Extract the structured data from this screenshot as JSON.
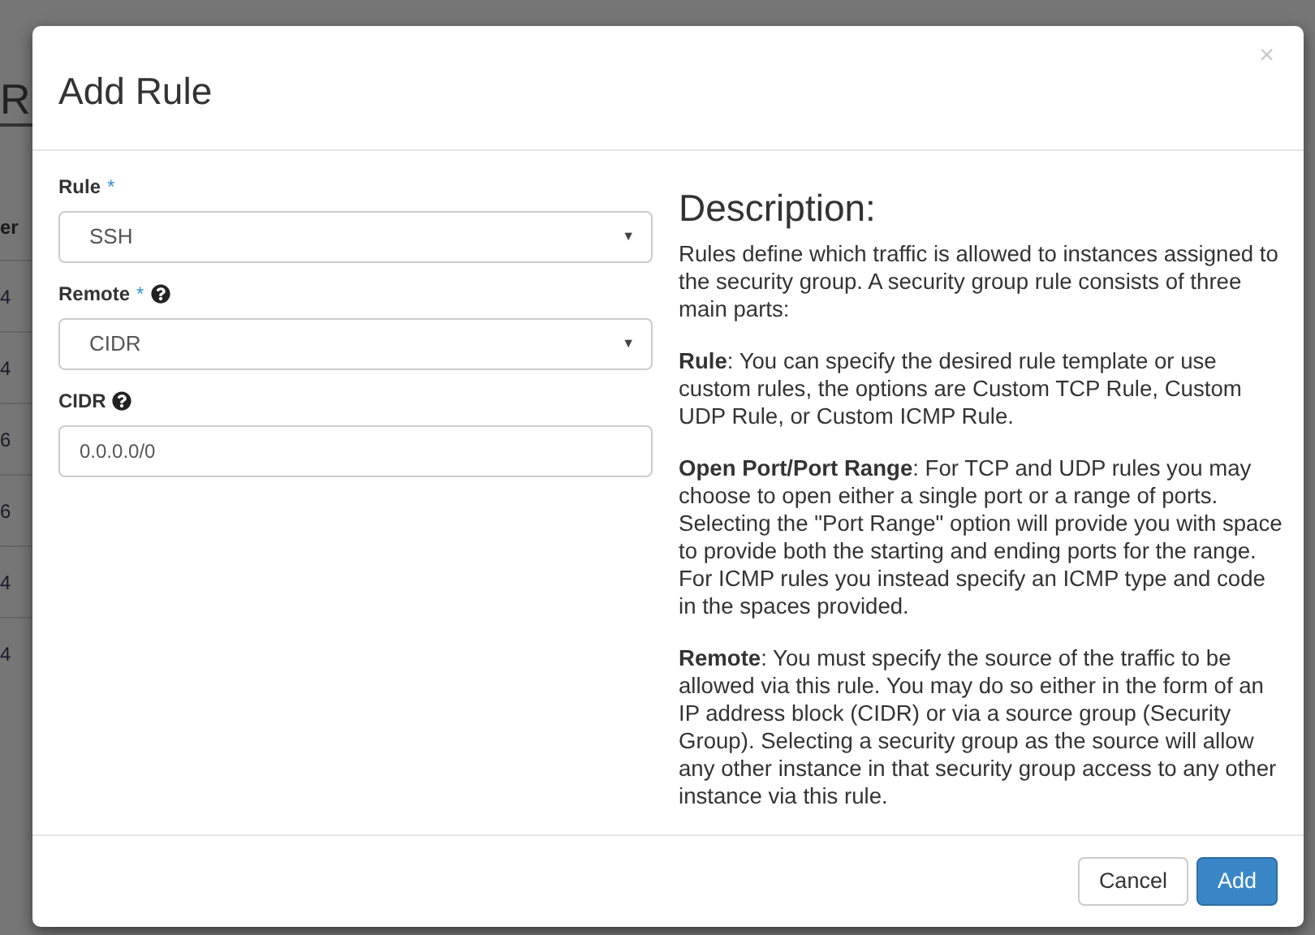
{
  "background_page": {
    "heading": "R",
    "column_header": "er",
    "cells": [
      "4",
      "4",
      "6",
      "6",
      "4",
      "4"
    ]
  },
  "dialog": {
    "title": "Add Rule",
    "close": "×",
    "fields": [
      {
        "kind": "select",
        "label": "Rule",
        "required": true,
        "required_mark": "*",
        "help": false,
        "value": "SSH",
        "caret": "▼"
      },
      {
        "kind": "select",
        "label": "Remote",
        "required": true,
        "required_mark": "*",
        "help": true,
        "value": "CIDR",
        "caret": "▼"
      },
      {
        "kind": "text",
        "label": "CIDR",
        "required": false,
        "help": true,
        "value": "0.0.0.0/0"
      }
    ],
    "description": {
      "heading": "Description:",
      "paragraphs": [
        "Rules define which traffic is allowed to instances assigned to the security group. A security group rule consists of three main parts:",
        "**Rule**: You can specify the desired rule template or use custom rules, the options are Custom TCP Rule, Custom UDP Rule, or Custom ICMP Rule.",
        "**Open Port/Port Range**: For TCP and UDP rules you may choose to open either a single port or a range of ports. Selecting the \"Port Range\" option will provide you with space to provide both the starting and ending ports for the range. For ICMP rules you instead specify an ICMP type and code in the spaces provided.",
        "**Remote**: You must specify the source of the traffic to be allowed via this rule. You may do so either in the form of an IP address block (CIDR) or via a source group (Security Group). Selecting a security group as the source will allow any other instance in that security group access to any other instance via this rule."
      ]
    },
    "buttons": [
      {
        "kind": "default",
        "label": "Cancel"
      },
      {
        "kind": "primary",
        "label": "Add"
      }
    ]
  }
}
